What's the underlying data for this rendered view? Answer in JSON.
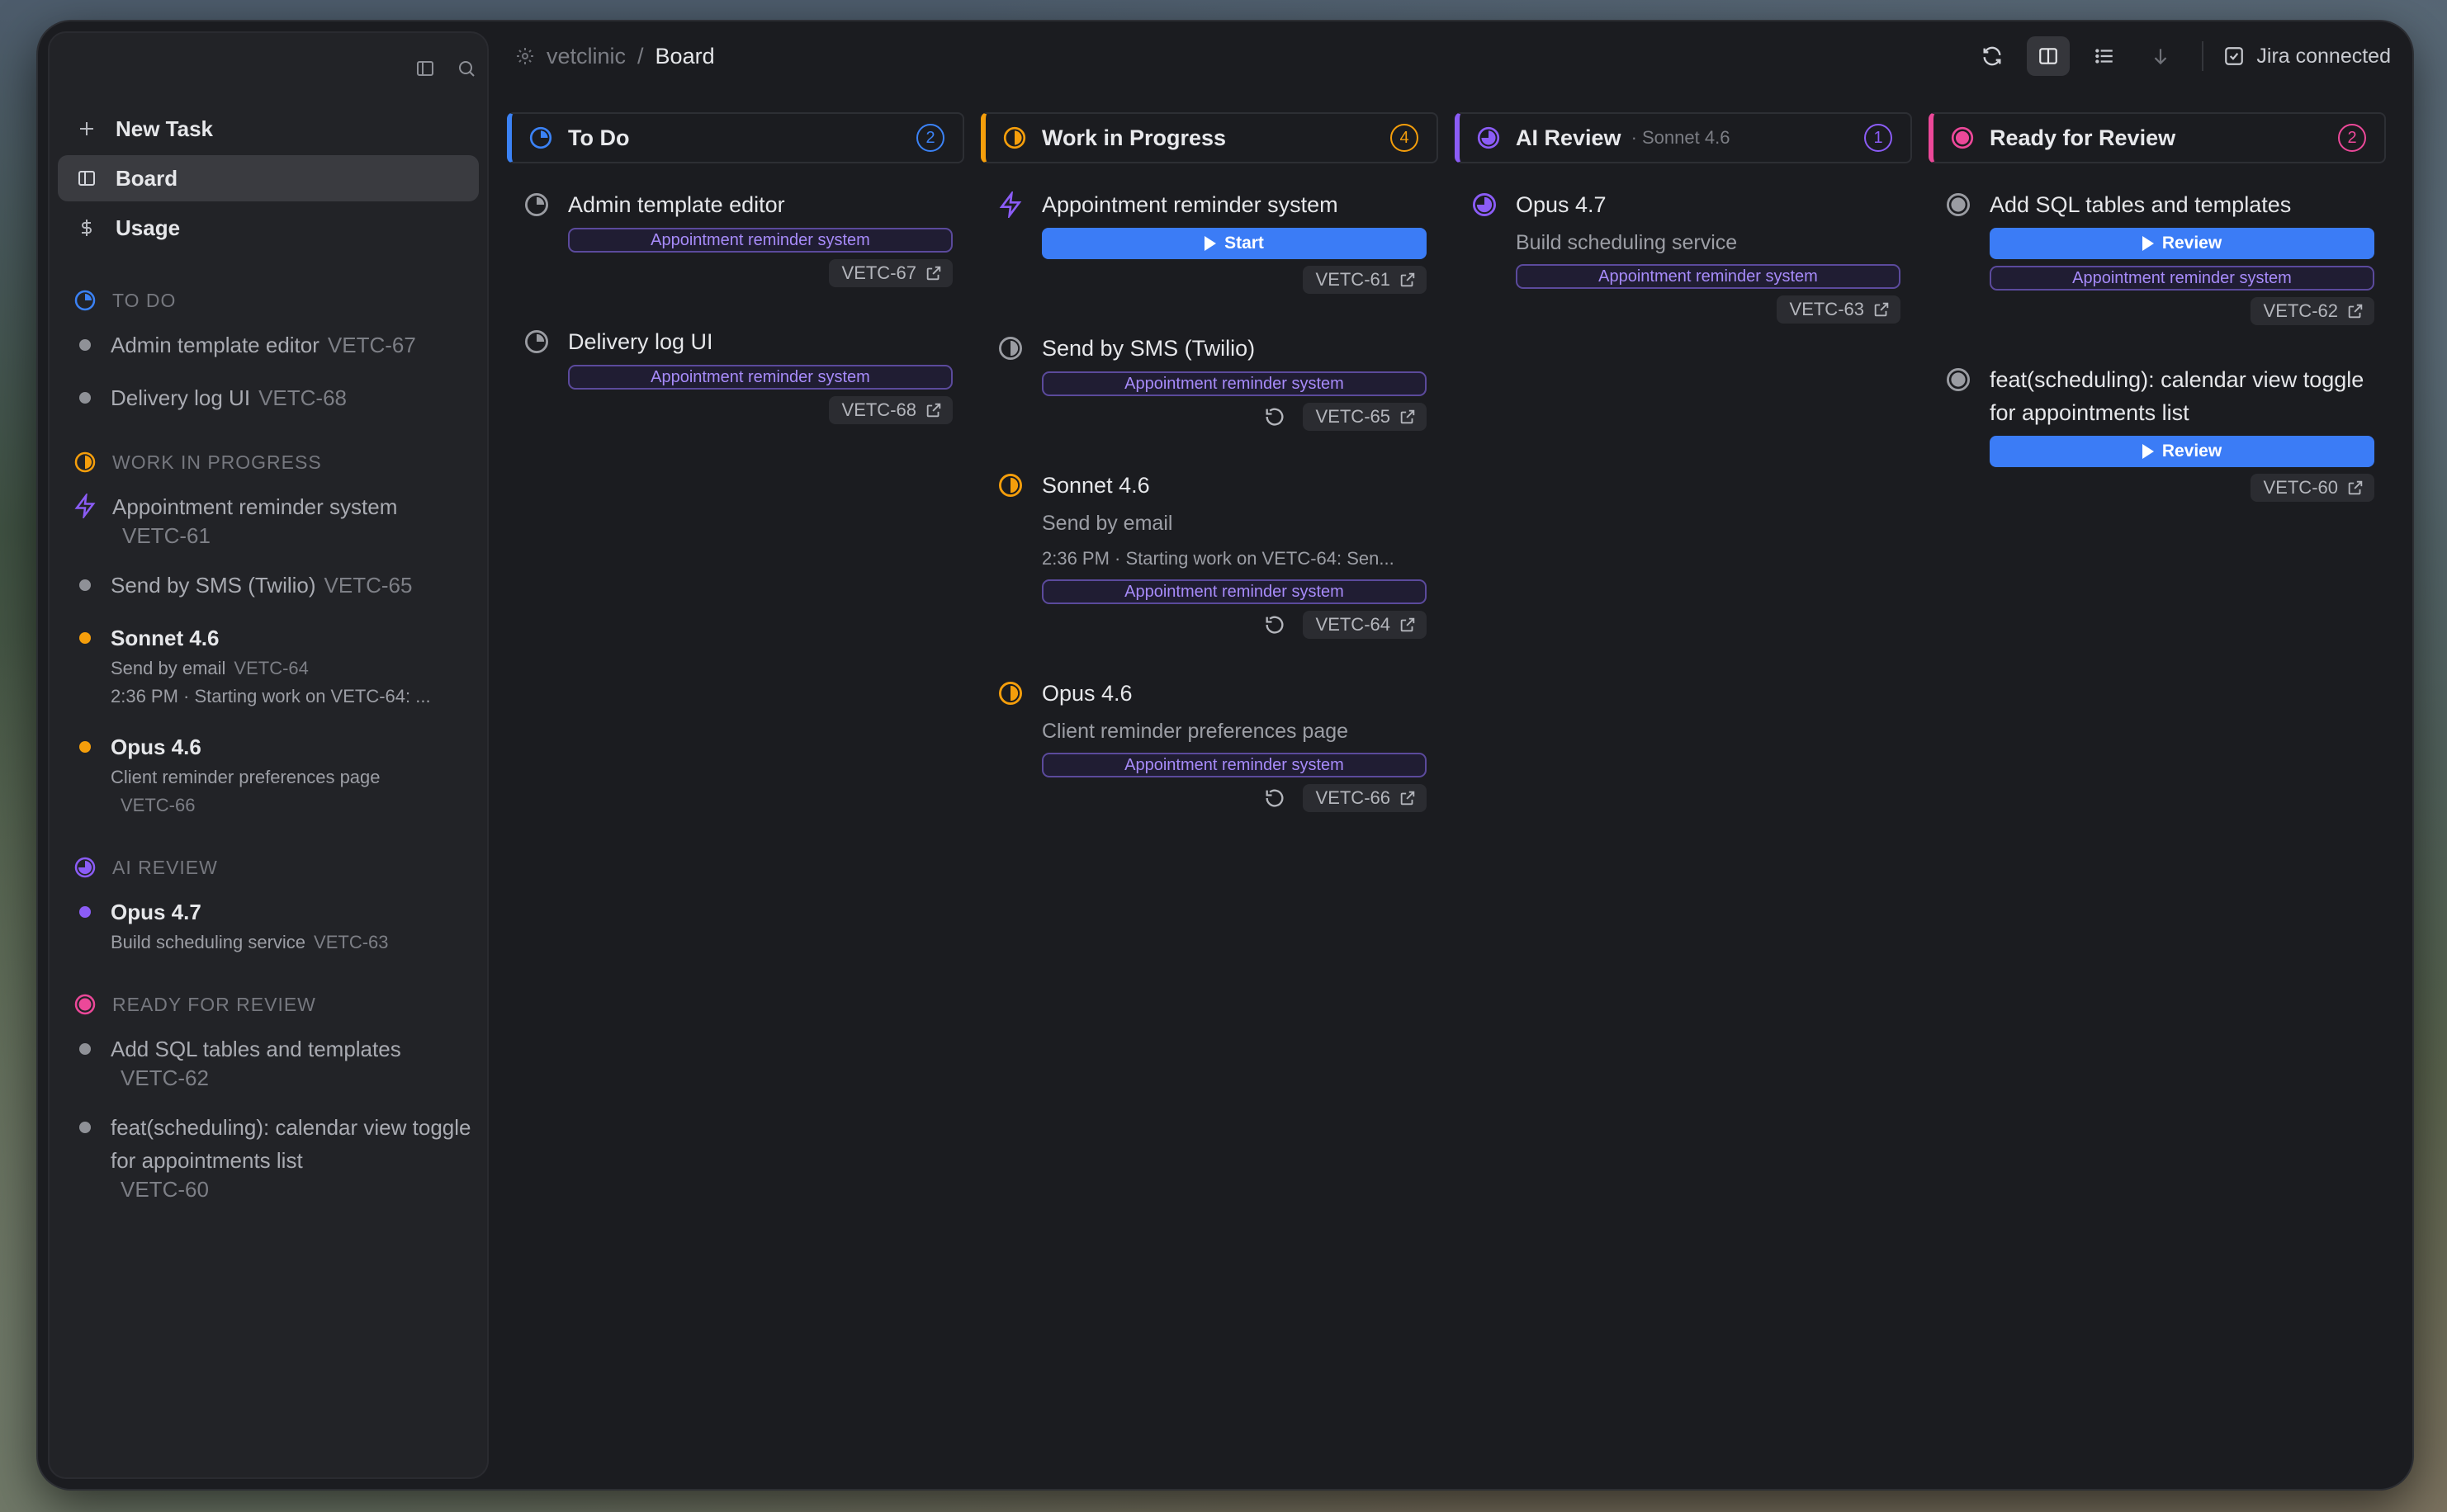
{
  "breadcrumb": {
    "project": "vetclinic",
    "separator": "/",
    "page": "Board"
  },
  "nav": {
    "new_task": "New Task",
    "board": "Board",
    "usage": "Usage"
  },
  "jira": {
    "label": "Jira connected"
  },
  "colors": {
    "todo": "#3b82f6",
    "wip": "#f59e0b",
    "ai": "#8b5cf6",
    "ready": "#ec4899",
    "accent_button": "#3b7cf6",
    "epic_text": "#a78bfa"
  },
  "sidebar": {
    "groups": [
      {
        "label": "TO DO",
        "tasks": [
          {
            "title": "Admin template editor",
            "key": "VETC-67"
          },
          {
            "title": "Delivery log UI",
            "key": "VETC-68"
          }
        ]
      },
      {
        "label": "WORK IN PROGRESS",
        "tasks": [
          {
            "title": "Appointment reminder system",
            "key": "VETC-61"
          },
          {
            "title": "Send by SMS (Twilio)",
            "key": "VETC-65"
          },
          {
            "title": "Sonnet 4.6",
            "subtitle": "Send by email",
            "key": "VETC-64",
            "status": "2:36 PM · Starting work on VETC-64: ..."
          },
          {
            "title": "Opus 4.6",
            "subtitle": "Client reminder preferences page",
            "key": "VETC-66"
          }
        ]
      },
      {
        "label": "AI REVIEW",
        "tasks": [
          {
            "title": "Opus 4.7",
            "subtitle": "Build scheduling service",
            "key": "VETC-63"
          }
        ]
      },
      {
        "label": "READY FOR REVIEW",
        "tasks": [
          {
            "title": "Add SQL tables and templates",
            "key": "VETC-62"
          },
          {
            "title": "feat(scheduling): calendar view toggle for appointments list",
            "key": "VETC-60"
          }
        ]
      }
    ]
  },
  "board": {
    "columns": [
      {
        "name": "To Do",
        "count": "2",
        "cards": [
          {
            "title": "Admin template editor",
            "epic": "Appointment reminder system",
            "key": "VETC-67"
          },
          {
            "title": "Delivery log UI",
            "epic": "Appointment reminder system",
            "key": "VETC-68"
          }
        ]
      },
      {
        "name": "Work in Progress",
        "count": "4",
        "cards": [
          {
            "title": "Appointment reminder system",
            "button": "Start",
            "key": "VETC-61"
          },
          {
            "title": "Send by SMS (Twilio)",
            "epic": "Appointment reminder system",
            "key": "VETC-65"
          },
          {
            "title": "Sonnet 4.6",
            "subtitle": "Send by email",
            "status": "2:36 PM · Starting work on VETC-64: Sen...",
            "epic": "Appointment reminder system",
            "key": "VETC-64"
          },
          {
            "title": "Opus 4.6",
            "subtitle": "Client reminder preferences page",
            "epic": "Appointment reminder system",
            "key": "VETC-66"
          }
        ]
      },
      {
        "name": "AI Review",
        "sub": "· Sonnet 4.6",
        "count": "1",
        "cards": [
          {
            "title": "Opus 4.7",
            "subtitle": "Build scheduling service",
            "epic": "Appointment reminder system",
            "key": "VETC-63"
          }
        ]
      },
      {
        "name": "Ready for Review",
        "count": "2",
        "cards": [
          {
            "title": "Add SQL tables and templates",
            "button": "Review",
            "epic": "Appointment reminder system",
            "key": "VETC-62"
          },
          {
            "title": "feat(scheduling): calendar view toggle for appointments list",
            "button": "Review",
            "key": "VETC-60"
          }
        ]
      }
    ]
  }
}
